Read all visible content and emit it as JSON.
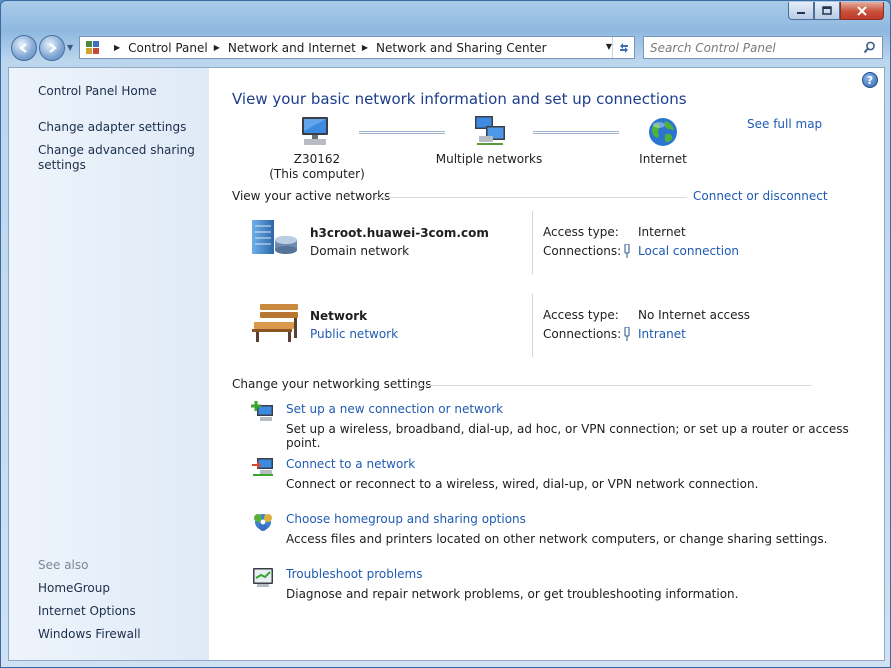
{
  "window": {
    "colors": {
      "title_link": "#1c3e8c",
      "link": "#1f5bb3"
    }
  },
  "navbar": {
    "breadcrumbs": [
      "Control Panel",
      "Network and Internet",
      "Network and Sharing Center"
    ],
    "search_placeholder": "Search Control Panel"
  },
  "sidebar": {
    "home": "Control Panel Home",
    "links": [
      "Change adapter settings",
      "Change advanced sharing",
      "settings"
    ],
    "see_also_heading": "See also",
    "see_also": [
      "HomeGroup",
      "Internet Options",
      "Windows Firewall"
    ]
  },
  "main": {
    "title": "View your basic network information and set up connections",
    "see_full_map": "See full map",
    "map": {
      "computer_name": "Z30162",
      "computer_sub": "(This computer)",
      "middle": "Multiple networks",
      "internet": "Internet"
    },
    "active_networks_heading": "View your active networks",
    "connect_or_disconnect": "Connect or disconnect",
    "networks": [
      {
        "name": "h3croot.huawei-3com.com",
        "type": "Domain network",
        "access_label": "Access type:",
        "access_value": "Internet",
        "connections_label": "Connections:",
        "connection": "Local connection"
      },
      {
        "name": "Network",
        "type": "Public network",
        "access_label": "Access type:",
        "access_value": "No Internet access",
        "connections_label": "Connections:",
        "connection": "Intranet"
      }
    ],
    "settings_heading": "Change your networking settings",
    "tasks": [
      {
        "link": "Set up a new connection or network",
        "desc": "Set up a wireless, broadband, dial-up, ad hoc, or VPN connection; or set up a router or access point."
      },
      {
        "link": "Connect to a network",
        "desc": "Connect or reconnect to a wireless, wired, dial-up, or VPN network connection."
      },
      {
        "link": "Choose homegroup and sharing options",
        "desc": "Access files and printers located on other network computers, or change sharing settings."
      },
      {
        "link": "Troubleshoot problems",
        "desc": "Diagnose and repair network problems, or get troubleshooting information."
      }
    ]
  }
}
